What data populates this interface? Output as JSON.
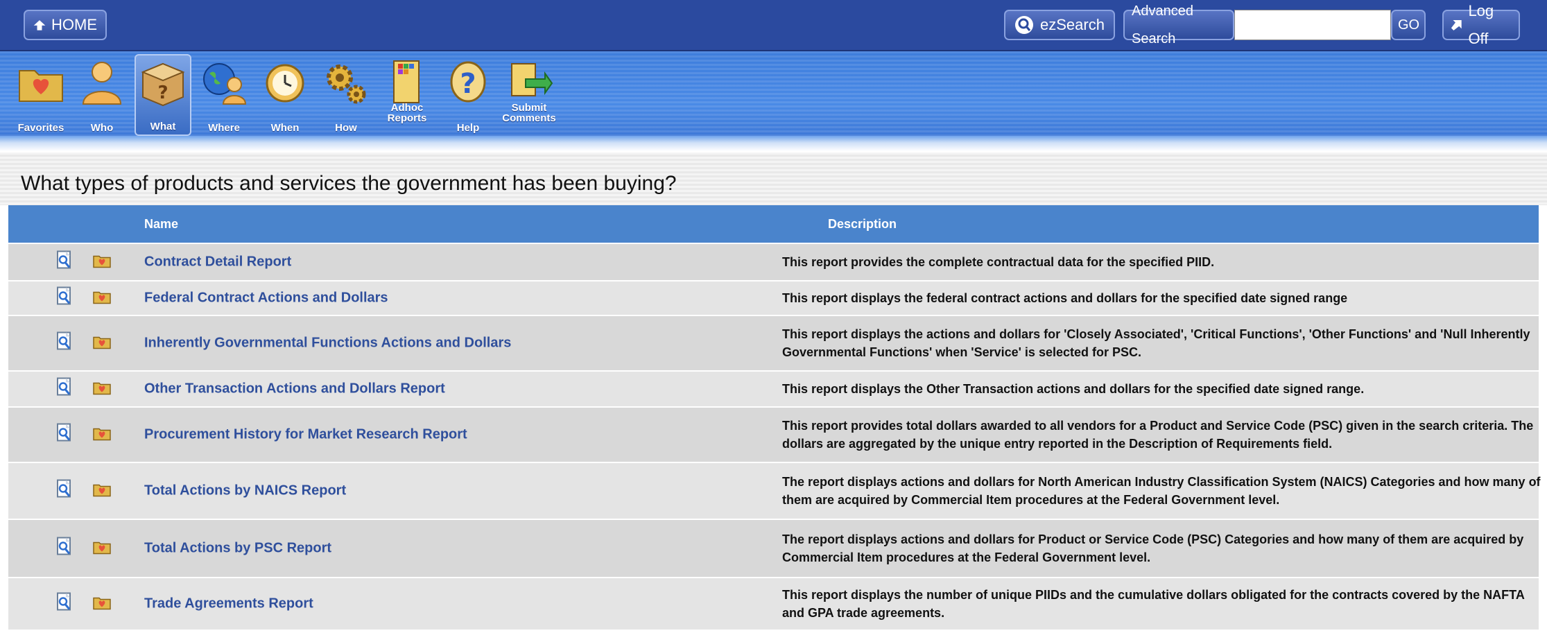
{
  "header": {
    "home_label": "HOME",
    "ezsearch_label": "ezSearch",
    "advanced_search_label": "Advanced Search",
    "search_value": "",
    "go_label": "GO",
    "logoff_label": "Log Off"
  },
  "toolbar": {
    "items": [
      {
        "label": "Favorites",
        "icon": "folder-heart-icon",
        "selected": false
      },
      {
        "label": "Who",
        "icon": "person-icon",
        "selected": false
      },
      {
        "label": "What",
        "icon": "box-question-icon",
        "selected": true
      },
      {
        "label": "Where",
        "icon": "globe-person-icon",
        "selected": false
      },
      {
        "label": "When",
        "icon": "clock-icon",
        "selected": false
      },
      {
        "label": "How",
        "icon": "gears-icon",
        "selected": false
      },
      {
        "label": "Adhoc Reports",
        "icon": "report-grid-icon",
        "selected": false
      },
      {
        "label": "Help",
        "icon": "help-icon",
        "selected": false
      },
      {
        "label": "Submit Comments",
        "icon": "submit-comments-icon",
        "selected": false
      }
    ]
  },
  "page": {
    "title": "What types of products and services the government has been buying?"
  },
  "table": {
    "columns": [
      "Name",
      "Description"
    ],
    "rows": [
      {
        "name": "Contract Detail Report",
        "description": "This report provides the complete contractual data for the specified PIID."
      },
      {
        "name": "Federal Contract Actions and Dollars",
        "description": "This report displays the federal contract actions and dollars for the specified date signed range"
      },
      {
        "name": "Inherently Governmental Functions Actions and Dollars",
        "description": "This report displays the actions and dollars for 'Closely Associated', 'Critical Functions', 'Other Functions' and 'Null Inherently Governmental Functions' when 'Service' is selected for PSC."
      },
      {
        "name": "Other Transaction Actions and Dollars Report",
        "description": "This report displays the Other Transaction actions and dollars for the specified date signed range."
      },
      {
        "name": "Procurement History for Market Research Report",
        "description": "This report provides total dollars awarded to all vendors for a Product and Service Code (PSC) given in the search criteria. The dollars are aggregated by the unique entry reported in the Description of Requirements field."
      },
      {
        "name": "Total Actions by NAICS Report",
        "description": "The report displays actions and dollars for North American Industry Classification System (NAICS) Categories and how many of them are acquired by Commercial Item procedures at the Federal Government level."
      },
      {
        "name": "Total Actions by PSC Report",
        "description": "The report displays actions and dollars for Product or Service Code (PSC) Categories and how many of them are acquired by Commercial Item procedures at the Federal Government level."
      },
      {
        "name": "Trade Agreements Report",
        "description": "This report displays the number of unique PIIDs and the cumulative dollars obligated for the contracts covered by the NAFTA and GPA trade agreements."
      }
    ]
  },
  "colors": {
    "top_bar": "#2b4a9f",
    "toolbar": "#4a8ae6",
    "table_header": "#4a84cc",
    "link": "#2f4f9c"
  }
}
